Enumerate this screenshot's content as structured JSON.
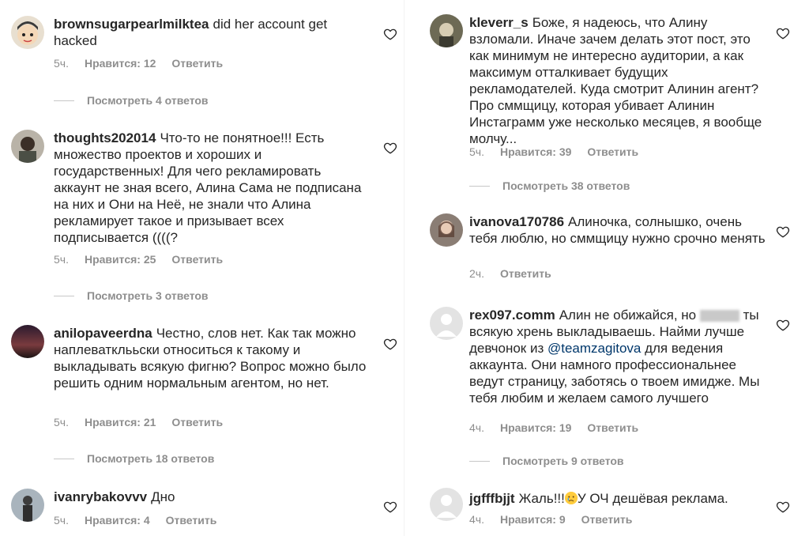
{
  "colors": {
    "text": "#262626",
    "muted": "#8e8e8e",
    "mention": "#00376b",
    "background": "#ffffff"
  },
  "icons": {
    "like": "heart-outline-icon"
  },
  "left_comments": [
    {
      "username": "brownsugarpearlmilktea",
      "text": "did her account get hacked",
      "time": "5ч.",
      "likes": "Нравится: 12",
      "reply": "Ответить",
      "view_replies": "Посмотреть 4 ответов"
    },
    {
      "username": "thoughts202014",
      "text": "Что-то не понятное!!! Есть множество проектов и хороших и государственных! Для чего рекламировать аккаунт не зная всего, Алина Сама не подписана на них и Они на Неё, не знали что Алина рекламирует такое и призывает всех подписывается ((((?",
      "time": "5ч.",
      "likes": "Нравится: 25",
      "reply": "Ответить",
      "view_replies": "Посмотреть 3 ответов"
    },
    {
      "username": "anilopaveerdna",
      "text": "Честно, слов нет. Как так можно наплеватклььски относиться к такому и выкладывать всякую фигню? Вопрос можно было решить одним нормальным агентом, но нет.",
      "time": "5ч.",
      "likes": "Нравится: 21",
      "reply": "Ответить",
      "view_replies": "Посмотреть 18 ответов"
    },
    {
      "username": "ivanrybakovvv",
      "text": "Дно",
      "time": "5ч.",
      "likes": "Нравится: 4",
      "reply": "Ответить"
    }
  ],
  "right_comments": [
    {
      "username": "kleverr_s",
      "text": "Боже, я надеюсь, что Алину взломали. Иначе зачем делать этот пост, это как минимум не интересно аудитории, а как максимум отталкивает будущих рекламодателей. Куда смотрит Алинин агент? Про сммщицу, которая убивает Алинин Инстаграмм уже несколько месяцев, я вообще молчу...",
      "time": "5ч.",
      "likes": "Нравится: 39",
      "reply": "Ответить",
      "view_replies": "Посмотреть 38 ответов"
    },
    {
      "username": "ivanova170786",
      "text": "Алиночка, солнышко, очень тебя люблю, но сммщицу нужно срочно менять",
      "time": "2ч.",
      "reply": "Ответить"
    },
    {
      "username": "rex097.comm",
      "text_part1": "Алин не обижайся, но",
      "text_part2": "ты всякую хрень выкладываешь. Найми лучше девчонок из",
      "mention": "@teamzagitova",
      "text_part3": "для ведения аккаунта. Они намного профессиональнее ведут страницу, заботясь о твоем имидже. Мы тебя любим  и желаем самого лучшего",
      "time": "4ч.",
      "likes": "Нравится: 19",
      "reply": "Ответить",
      "view_replies": "Посмотреть 9 ответов"
    },
    {
      "username": "jgfffbjjt",
      "text_part1": "Жаль!!!",
      "text_part2": "У ОЧ дешёвая реклама.",
      "time": "4ч.",
      "likes": "Нравится: 9",
      "reply": "Ответить"
    }
  ]
}
